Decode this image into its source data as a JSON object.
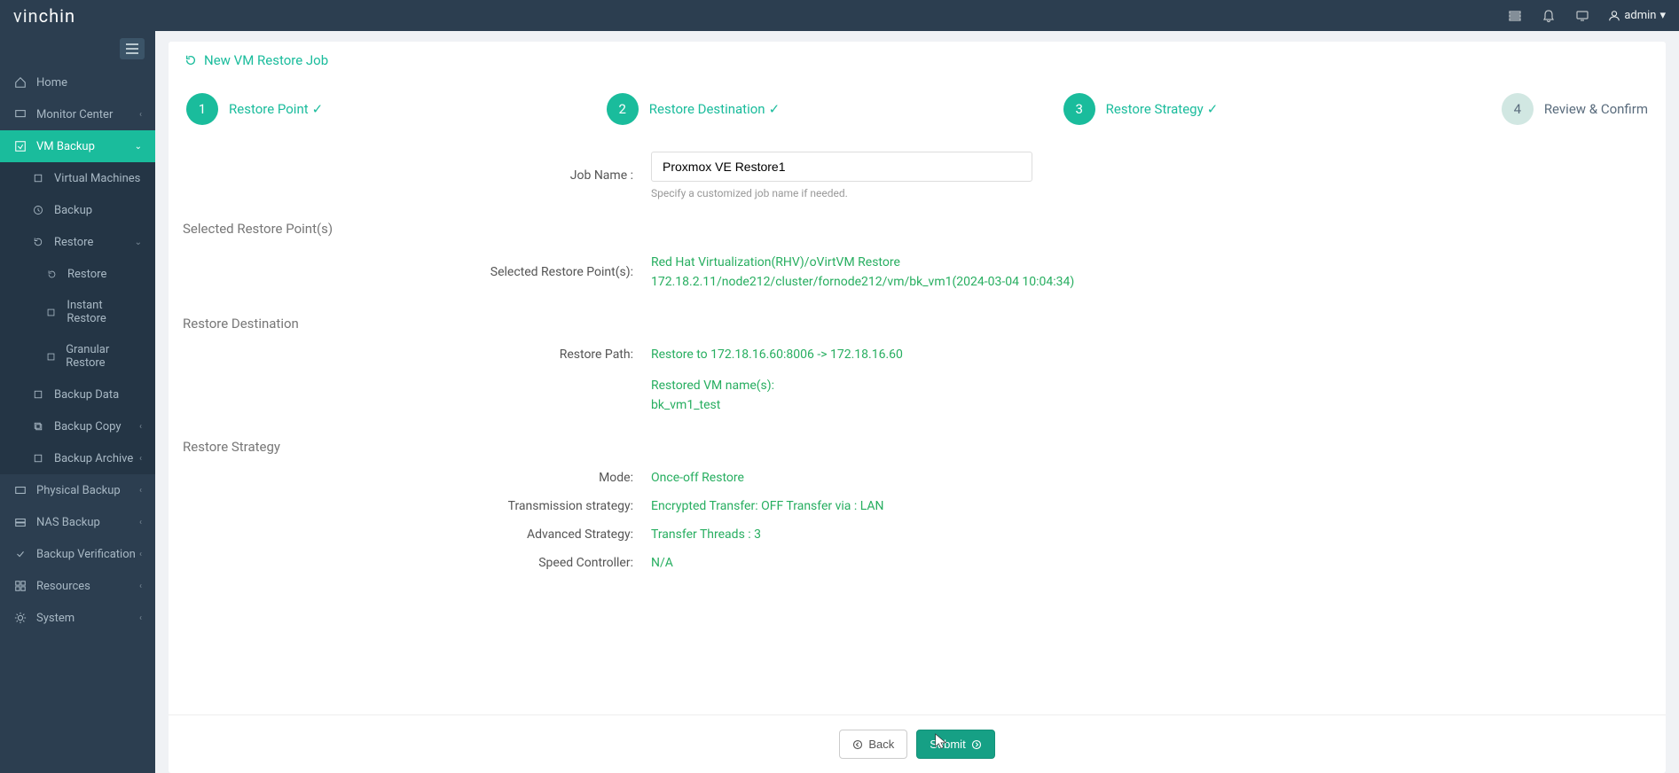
{
  "brand": {
    "part1": "vin",
    "part2": "chin"
  },
  "topbar": {
    "user_label": "admin"
  },
  "sidebar": {
    "home": "Home",
    "monitor": "Monitor Center",
    "vmbackup": "VM Backup",
    "virtual_machines": "Virtual Machines",
    "backup": "Backup",
    "restore": "Restore",
    "restore_sub": "Restore",
    "instant_restore": "Instant Restore",
    "granular_restore": "Granular Restore",
    "backup_data": "Backup Data",
    "backup_copy": "Backup Copy",
    "backup_archive": "Backup Archive",
    "physical_backup": "Physical Backup",
    "nas_backup": "NAS Backup",
    "backup_verification": "Backup Verification",
    "resources": "Resources",
    "system": "System"
  },
  "page": {
    "title": "New VM Restore Job",
    "steps": {
      "s1": "Restore Point",
      "s2": "Restore Destination",
      "s3": "Restore Strategy",
      "s4": "Review & Confirm"
    },
    "job_name_label": "Job Name :",
    "job_name_value": "Proxmox VE Restore1",
    "job_name_hint": "Specify a customized job name if needed.",
    "sections": {
      "restore_point": {
        "header": "Selected Restore Point(s)",
        "label": "Selected Restore Point(s):",
        "line1": "Red Hat Virtualization(RHV)/oVirtVM Restore",
        "line2": "172.18.2.11/node212/cluster/fornode212/vm/bk_vm1(2024-03-04 10:04:34)"
      },
      "destination": {
        "header": "Restore Destination",
        "path_label": "Restore Path:",
        "path_value": "Restore to 172.18.16.60:8006 -> 172.18.16.60",
        "names_label": "Restored VM name(s):",
        "names_value": "bk_vm1_test"
      },
      "strategy": {
        "header": "Restore Strategy",
        "mode_label": "Mode:",
        "mode_value": "Once-off Restore",
        "trans_label": "Transmission strategy:",
        "trans_value": "Encrypted Transfer: OFF Transfer via : LAN",
        "adv_label": "Advanced Strategy:",
        "adv_value": "Transfer Threads : 3",
        "speed_label": "Speed Controller:",
        "speed_value": "N/A"
      }
    },
    "buttons": {
      "back": "Back",
      "submit": "Submit"
    }
  },
  "colors": {
    "accent": "#1abc9c",
    "dark": "#2c3e50",
    "value": "#27ae60"
  }
}
